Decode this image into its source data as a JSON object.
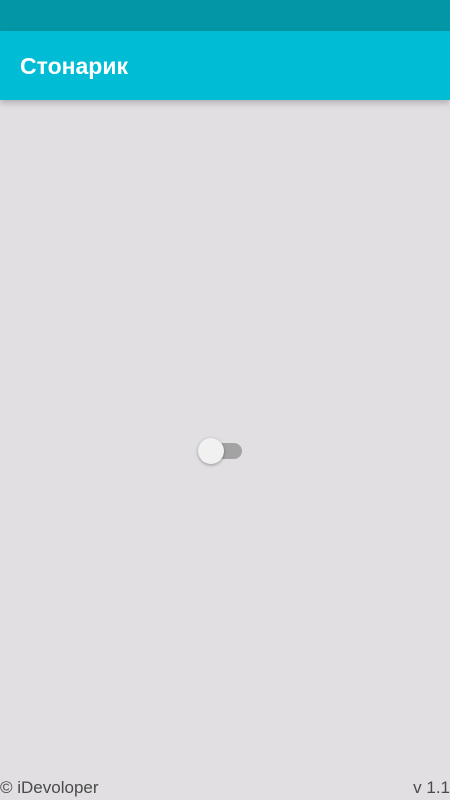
{
  "app_bar": {
    "title": "Стонарик",
    "color": "#00bcd4"
  },
  "status_bar": {
    "color": "#0396a6"
  },
  "flashlight_switch": {
    "checked": false
  },
  "footer": {
    "copyright": "© iDevoloper",
    "version": "v 1.1"
  }
}
